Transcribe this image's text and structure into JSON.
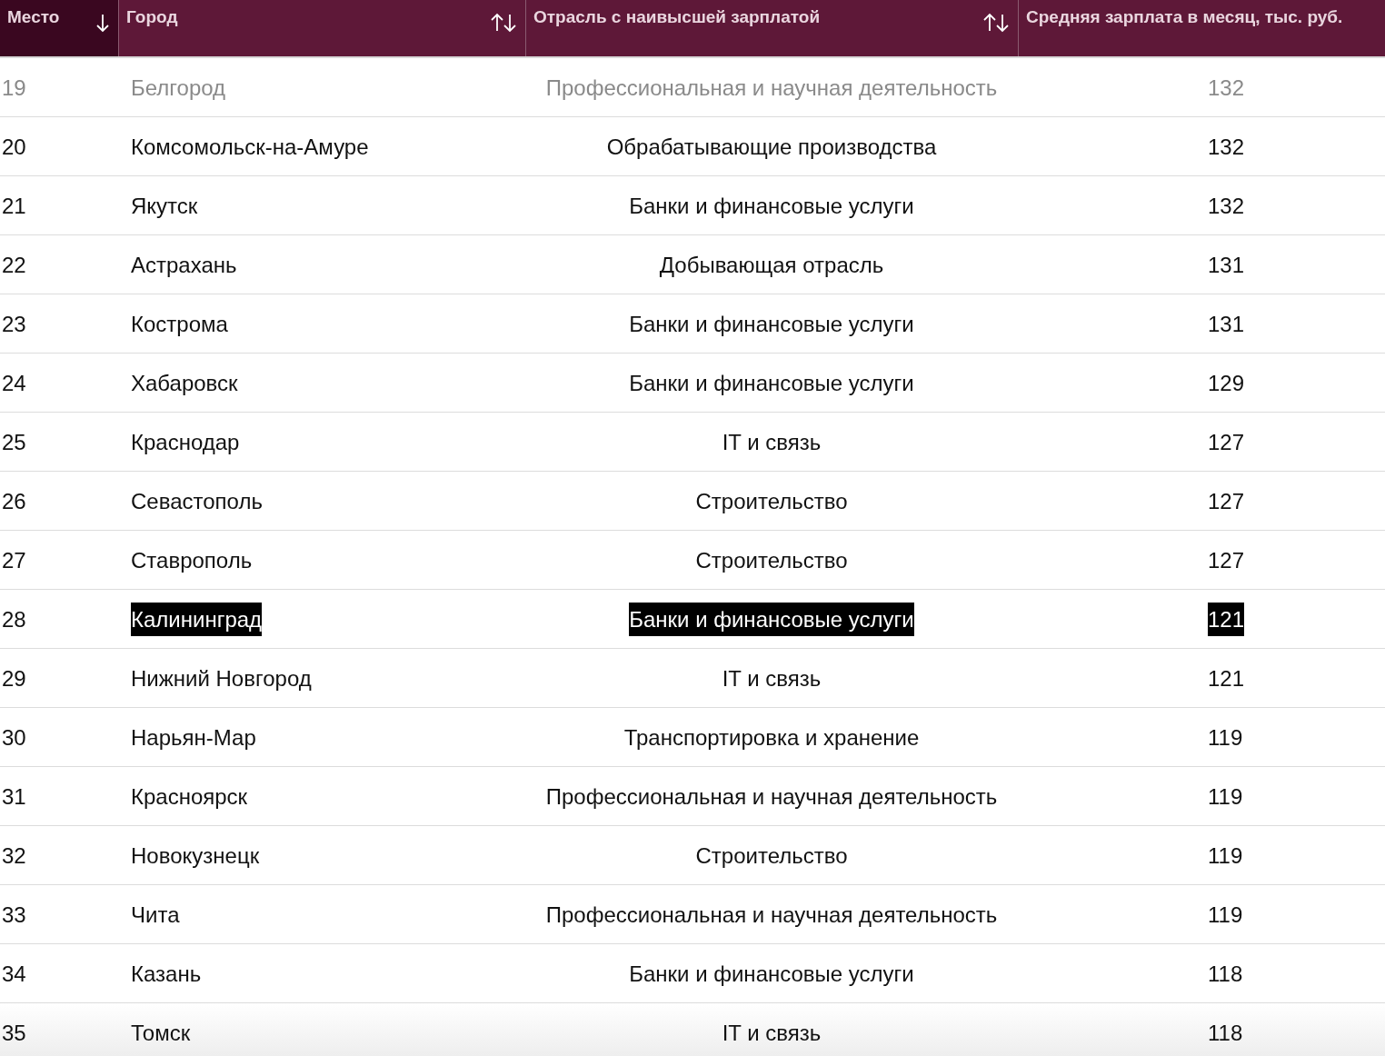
{
  "columns": [
    {
      "label": "Место",
      "sorted": true,
      "active": true
    },
    {
      "label": "Город",
      "sortable": true,
      "sorted": false,
      "active": false
    },
    {
      "label": "Отрасль с наивысшей зарплатой",
      "sortable": true,
      "sorted": false,
      "active": false
    },
    {
      "label": "Средняя зарплата в месяц, тыс. руб.",
      "sortable": false,
      "active": false
    }
  ],
  "rows": [
    {
      "rank": "19",
      "city": "Белгород",
      "industry": "Профессиональная и научная деятельность",
      "salary": "132",
      "dimmed": true,
      "highlighted": false
    },
    {
      "rank": "20",
      "city": "Комсомольск-на-Амуре",
      "industry": "Обрабатывающие производства",
      "salary": "132",
      "dimmed": false,
      "highlighted": false
    },
    {
      "rank": "21",
      "city": "Якутск",
      "industry": "Банки и финансовые услуги",
      "salary": "132",
      "dimmed": false,
      "highlighted": false
    },
    {
      "rank": "22",
      "city": "Астрахань",
      "industry": "Добывающая отрасль",
      "salary": "131",
      "dimmed": false,
      "highlighted": false
    },
    {
      "rank": "23",
      "city": "Кострома",
      "industry": "Банки и финансовые услуги",
      "salary": "131",
      "dimmed": false,
      "highlighted": false
    },
    {
      "rank": "24",
      "city": "Хабаровск",
      "industry": "Банки и финансовые услуги",
      "salary": "129",
      "dimmed": false,
      "highlighted": false
    },
    {
      "rank": "25",
      "city": "Краснодар",
      "industry": "IT и связь",
      "salary": "127",
      "dimmed": false,
      "highlighted": false
    },
    {
      "rank": "26",
      "city": "Севастополь",
      "industry": "Строительство",
      "salary": "127",
      "dimmed": false,
      "highlighted": false
    },
    {
      "rank": "27",
      "city": "Ставрополь",
      "industry": "Строительство",
      "salary": "127",
      "dimmed": false,
      "highlighted": false
    },
    {
      "rank": "28",
      "city": "Калининград",
      "industry": "Банки и финансовые услуги",
      "salary": "121",
      "dimmed": false,
      "highlighted": true
    },
    {
      "rank": "29",
      "city": "Нижний Новгород",
      "industry": "IT и связь",
      "salary": "121",
      "dimmed": false,
      "highlighted": false
    },
    {
      "rank": "30",
      "city": "Нарьян-Мар",
      "industry": "Транспортировка и хранение",
      "salary": "119",
      "dimmed": false,
      "highlighted": false
    },
    {
      "rank": "31",
      "city": "Красноярск",
      "industry": "Профессиональная и научная деятельность",
      "salary": "119",
      "dimmed": false,
      "highlighted": false
    },
    {
      "rank": "32",
      "city": "Новокузнецк",
      "industry": "Строительство",
      "salary": "119",
      "dimmed": false,
      "highlighted": false
    },
    {
      "rank": "33",
      "city": "Чита",
      "industry": "Профессиональная и научная деятельность",
      "salary": "119",
      "dimmed": false,
      "highlighted": false
    },
    {
      "rank": "34",
      "city": "Казань",
      "industry": "Банки и финансовые услуги",
      "salary": "118",
      "dimmed": false,
      "highlighted": false
    },
    {
      "rank": "35",
      "city": "Томск",
      "industry": "IT и связь",
      "salary": "118",
      "dimmed": false,
      "highlighted": false
    }
  ]
}
